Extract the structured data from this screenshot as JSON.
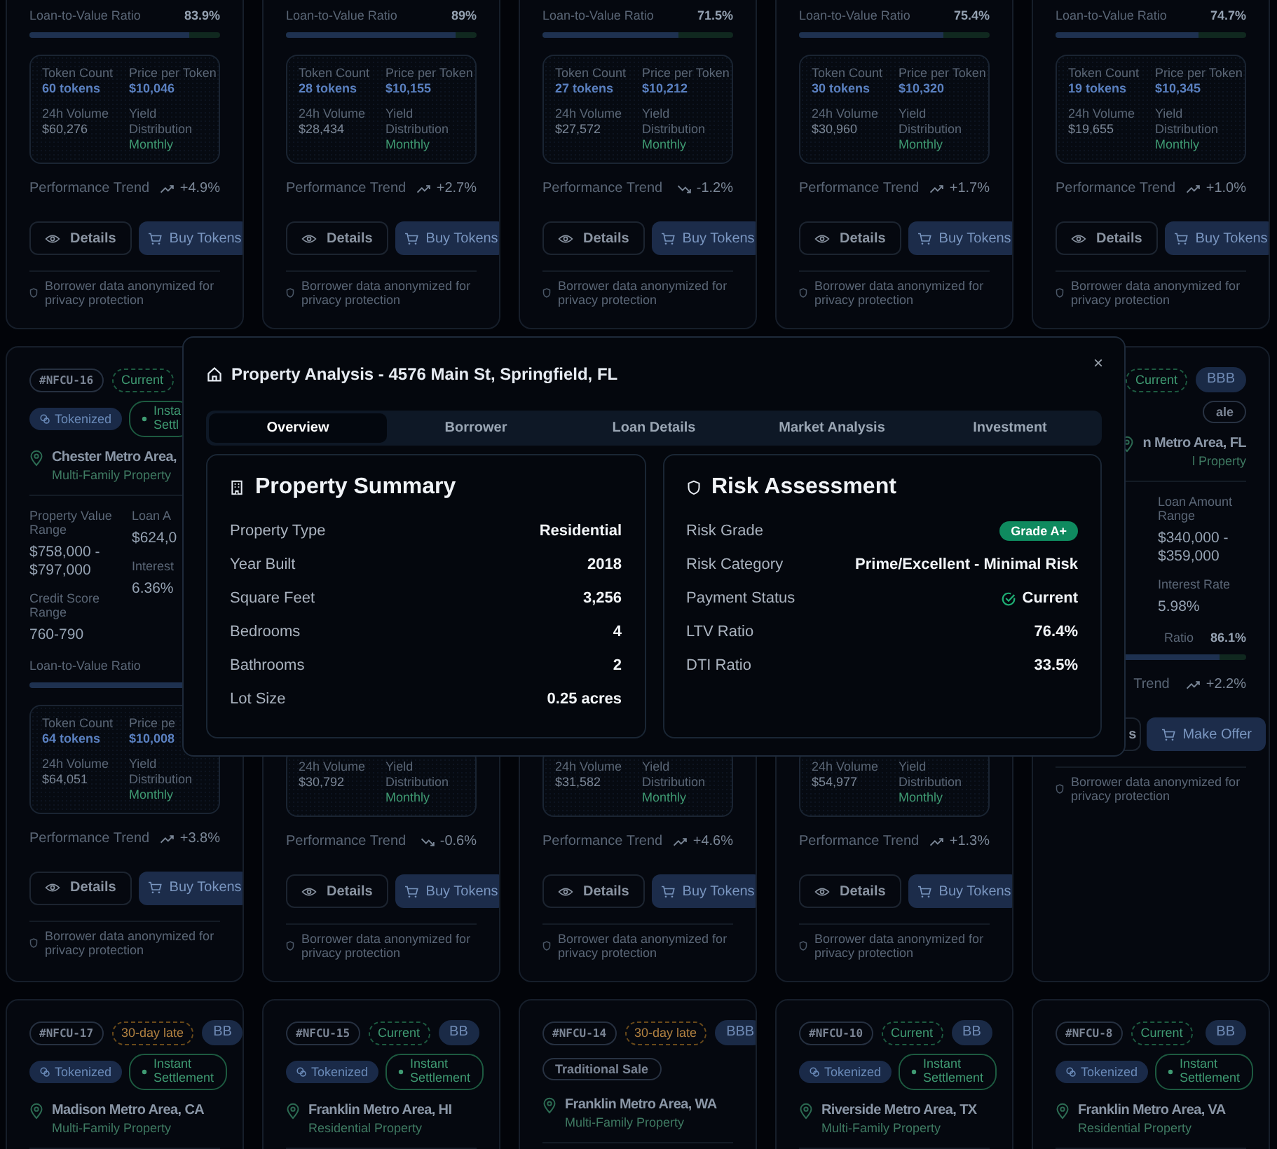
{
  "cards": [
    {
      "ltv": {
        "label": "Loan-to-Value Ratio",
        "value": "83.9%",
        "level": 0.839
      },
      "tokens": [
        {
          "kind": "count",
          "label": "Token Count",
          "value": "60 tokens"
        },
        {
          "kind": "price",
          "label": "Price per Token",
          "value": "$10,046"
        },
        {
          "kind": "volume",
          "label": "24h Volume",
          "value": "$60,276"
        },
        {
          "kind": "yield",
          "label": "Yield Distribution",
          "value": "Monthly"
        }
      ],
      "trend": {
        "label": "Performance Trend",
        "value": "+4.9%",
        "kind": "up"
      },
      "buttons": [
        {
          "kind": "outline",
          "label": "Details"
        },
        {
          "kind": "primary",
          "label": "Buy Tokens"
        }
      ],
      "note": "Borrower data anonymized for privacy protection"
    },
    {
      "ltv": {
        "label": "Loan-to-Value Ratio",
        "value": "89%",
        "level": 0.89
      },
      "tokens": [
        {
          "kind": "count",
          "label": "Token Count",
          "value": "28 tokens"
        },
        {
          "kind": "price",
          "label": "Price per Token",
          "value": "$10,155"
        },
        {
          "kind": "volume",
          "label": "24h Volume",
          "value": "$28,434"
        },
        {
          "kind": "yield",
          "label": "Yield Distribution",
          "value": "Monthly"
        }
      ],
      "trend": {
        "label": "Performance Trend",
        "value": "+2.7%",
        "kind": "up"
      },
      "buttons": [
        {
          "kind": "outline",
          "label": "Details"
        },
        {
          "kind": "primary",
          "label": "Buy Tokens"
        }
      ],
      "note": "Borrower data anonymized for privacy protection"
    },
    {
      "ltv": {
        "label": "Loan-to-Value Ratio",
        "value": "71.5%",
        "level": 0.715
      },
      "tokens": [
        {
          "kind": "count",
          "label": "Token Count",
          "value": "27 tokens"
        },
        {
          "kind": "price",
          "label": "Price per Token",
          "value": "$10,212"
        },
        {
          "kind": "volume",
          "label": "24h Volume",
          "value": "$27,572"
        },
        {
          "kind": "yield",
          "label": "Yield Distribution",
          "value": "Monthly"
        }
      ],
      "trend": {
        "label": "Performance Trend",
        "value": "-1.2%",
        "kind": "down"
      },
      "buttons": [
        {
          "kind": "outline",
          "label": "Details"
        },
        {
          "kind": "primary",
          "label": "Buy Tokens"
        }
      ],
      "note": "Borrower data anonymized for privacy protection"
    },
    {
      "ltv": {
        "label": "Loan-to-Value Ratio",
        "value": "75.4%",
        "level": 0.754
      },
      "tokens": [
        {
          "kind": "count",
          "label": "Token Count",
          "value": "30 tokens"
        },
        {
          "kind": "price",
          "label": "Price per Token",
          "value": "$10,320"
        },
        {
          "kind": "volume",
          "label": "24h Volume",
          "value": "$30,960"
        },
        {
          "kind": "yield",
          "label": "Yield Distribution",
          "value": "Monthly"
        }
      ],
      "trend": {
        "label": "Performance Trend",
        "value": "+1.7%",
        "kind": "up"
      },
      "buttons": [
        {
          "kind": "outline",
          "label": "Details"
        },
        {
          "kind": "primary",
          "label": "Buy Tokens"
        }
      ],
      "note": "Borrower data anonymized for privacy protection"
    },
    {
      "ltv": {
        "label": "Loan-to-Value Ratio",
        "value": "74.7%",
        "level": 0.747
      },
      "tokens": [
        {
          "kind": "count",
          "label": "Token Count",
          "value": "19 tokens"
        },
        {
          "kind": "price",
          "label": "Price per Token",
          "value": "$10,345"
        },
        {
          "kind": "volume",
          "label": "24h Volume",
          "value": "$19,655"
        },
        {
          "kind": "yield",
          "label": "Yield Distribution",
          "value": "Monthly"
        }
      ],
      "trend": {
        "label": "Performance Trend",
        "value": "+1.0%",
        "kind": "up"
      },
      "buttons": [
        {
          "kind": "outline",
          "label": "Details"
        },
        {
          "kind": "primary",
          "label": "Buy Tokens"
        }
      ],
      "note": "Borrower data anonymized for privacy protection"
    },
    {
      "tags": [
        {
          "kind": "id",
          "label": "#NFCU-16"
        },
        {
          "kind": "current",
          "label": "Current"
        }
      ],
      "badges": [
        {
          "kind": "tokenized",
          "label": "Tokenized"
        },
        {
          "kind": "instant",
          "label": "Insta Settl"
        }
      ],
      "location": "Chester Metro Area,",
      "type": "Multi-Family Property",
      "grid": {
        "left": [
          {
            "label": "Property Value Range",
            "value": "$758,000 - $797,000"
          },
          {
            "label": "Credit Score Range",
            "value": "760-790"
          }
        ],
        "right": [
          {
            "label": "Loan A",
            "value": "$624,0"
          },
          {
            "label": "Interest",
            "value": "6.36%"
          }
        ]
      },
      "ltv": {
        "label": "Loan-to-Value Ratio"
      },
      "tokens": [
        {
          "kind": "count",
          "label": "Token Count",
          "value": "64 tokens"
        },
        {
          "kind": "price",
          "label": "Price pe",
          "value": "$10,008"
        },
        {
          "kind": "volume",
          "label": "24h Volume",
          "value": "$64,051"
        },
        {
          "kind": "yield",
          "label": "Yield Distribution",
          "value": "Monthly"
        }
      ],
      "trend": {
        "label": "Performance Trend",
        "value": "+3.8%",
        "kind": "up"
      },
      "buttons": [
        {
          "kind": "outline",
          "label": "Details"
        },
        {
          "kind": "primary",
          "label": "Buy Tokens"
        }
      ],
      "note": "Borrower data anonymized for privacy protection"
    },
    {
      "tokens": [
        {
          "kind": "volume",
          "label": "24h Volume",
          "value": "$30,792"
        },
        {
          "kind": "yield",
          "label": "Yield Distribution",
          "value": "Monthly"
        }
      ],
      "trend": {
        "label": "Performance Trend",
        "value": "-0.6%",
        "kind": "down"
      },
      "buttons": [
        {
          "kind": "outline",
          "label": "Details"
        },
        {
          "kind": "primary",
          "label": "Buy Tokens"
        }
      ],
      "note": "Borrower data anonymized for privacy protection"
    },
    {
      "tokens": [
        {
          "kind": "volume",
          "label": "24h Volume",
          "value": "$31,582"
        },
        {
          "kind": "yield",
          "label": "Yield Distribution",
          "value": "Monthly"
        }
      ],
      "trend": {
        "label": "Performance Trend",
        "value": "+4.6%",
        "kind": "up"
      },
      "buttons": [
        {
          "kind": "outline",
          "label": "Details"
        },
        {
          "kind": "primary",
          "label": "Buy Tokens"
        }
      ],
      "note": "Borrower data anonymized for privacy protection"
    },
    {
      "tokens": [
        {
          "kind": "volume",
          "label": "24h Volume",
          "value": "$54,977"
        },
        {
          "kind": "yield",
          "label": "Yield Distribution",
          "value": "Monthly"
        }
      ],
      "trend": {
        "label": "Performance Trend",
        "value": "+1.3%",
        "kind": "up"
      },
      "buttons": [
        {
          "kind": "outline",
          "label": "Details"
        },
        {
          "kind": "primary",
          "label": "Buy Tokens"
        }
      ],
      "note": "Borrower data anonymized for privacy protection"
    },
    {
      "tags": [
        {
          "kind": "current",
          "label": "Current"
        },
        {
          "kind": "grade",
          "label": "BBB"
        }
      ],
      "badges": [
        {
          "kind": "sale",
          "label": "ale"
        }
      ],
      "location": "n Metro Area, FL",
      "type": "l Property",
      "grid": {
        "right": [
          {
            "label": "Loan Amount Range",
            "value": "$340,000 - $359,000"
          },
          {
            "label": "Interest Rate",
            "value": "5.98%"
          }
        ]
      },
      "ltv": {
        "label": "Ratio",
        "value": "86.1%",
        "level": 0.861
      },
      "trend": {
        "label": "Trend",
        "value": "+2.2%",
        "kind": "up"
      },
      "buttons": [
        {
          "kind": "outline",
          "label": "s"
        },
        {
          "kind": "primary",
          "label": "Make Offer"
        }
      ],
      "note": "Borrower data anonymized for privacy protection"
    },
    {
      "tags": [
        {
          "kind": "id",
          "label": "#NFCU-17"
        },
        {
          "kind": "late",
          "label": "30-day late"
        },
        {
          "kind": "grade",
          "label": "BB"
        }
      ],
      "badges": [
        {
          "kind": "tokenized",
          "label": "Tokenized"
        },
        {
          "kind": "instant",
          "label": "Instant Settlement"
        }
      ],
      "location": "Madison Metro Area, CA",
      "type": "Multi-Family Property"
    },
    {
      "tags": [
        {
          "kind": "id",
          "label": "#NFCU-15"
        },
        {
          "kind": "current",
          "label": "Current"
        },
        {
          "kind": "grade",
          "label": "BB"
        }
      ],
      "badges": [
        {
          "kind": "tokenized",
          "label": "Tokenized"
        },
        {
          "kind": "instant",
          "label": "Instant Settlement"
        }
      ],
      "location": "Franklin Metro Area, HI",
      "type": "Residential Property"
    },
    {
      "tags": [
        {
          "kind": "id",
          "label": "#NFCU-14"
        },
        {
          "kind": "late",
          "label": "30-day late"
        },
        {
          "kind": "grade",
          "label": "BBB"
        }
      ],
      "badges": [
        {
          "kind": "sale",
          "label": "Traditional Sale"
        }
      ],
      "location": "Franklin Metro Area, WA",
      "type": "Multi-Family Property"
    },
    {
      "tags": [
        {
          "kind": "id",
          "label": "#NFCU-10"
        },
        {
          "kind": "current",
          "label": "Current"
        },
        {
          "kind": "grade",
          "label": "BB"
        }
      ],
      "badges": [
        {
          "kind": "tokenized",
          "label": "Tokenized"
        },
        {
          "kind": "instant",
          "label": "Instant Settlement"
        }
      ],
      "location": "Riverside Metro Area, TX",
      "type": "Multi-Family Property"
    },
    {
      "tags": [
        {
          "kind": "id",
          "label": "#NFCU-8"
        },
        {
          "kind": "current",
          "label": "Current"
        },
        {
          "kind": "grade",
          "label": "BB"
        }
      ],
      "badges": [
        {
          "kind": "tokenized",
          "label": "Tokenized"
        },
        {
          "kind": "instant",
          "label": "Instant Settlement"
        }
      ],
      "location": "Franklin Metro Area, VA",
      "type": "Residential Property"
    }
  ],
  "modal": {
    "title": "Property Analysis - 4576 Main St, Springfield, FL",
    "close": "×",
    "tabs": [
      {
        "label": "Overview",
        "selected": true
      },
      {
        "label": "Borrower",
        "selected": false
      },
      {
        "label": "Loan Details",
        "selected": false
      },
      {
        "label": "Market Analysis",
        "selected": false
      },
      {
        "label": "Investment",
        "selected": false
      }
    ],
    "panels": [
      {
        "title": "Property Summary",
        "rows": [
          {
            "kind": "text",
            "label": "Property Type",
            "value": "Residential"
          },
          {
            "kind": "text",
            "label": "Year Built",
            "value": "2018"
          },
          {
            "kind": "text",
            "label": "Square Feet",
            "value": "3,256"
          },
          {
            "kind": "text",
            "label": "Bedrooms",
            "value": "4"
          },
          {
            "kind": "text",
            "label": "Bathrooms",
            "value": "2"
          },
          {
            "kind": "text",
            "label": "Lot Size",
            "value": "0.25 acres"
          }
        ]
      },
      {
        "title": "Risk Assessment",
        "rows": [
          {
            "kind": "badge",
            "label": "Risk Grade",
            "value": "Grade A+"
          },
          {
            "kind": "text",
            "label": "Risk Category",
            "value": "Prime/Excellent - Minimal Risk"
          },
          {
            "kind": "status",
            "label": "Payment Status",
            "value": "Current"
          },
          {
            "kind": "text",
            "label": "LTV Ratio",
            "value": "76.4%"
          },
          {
            "kind": "text",
            "label": "DTI Ratio",
            "value": "33.5%"
          }
        ]
      }
    ]
  }
}
